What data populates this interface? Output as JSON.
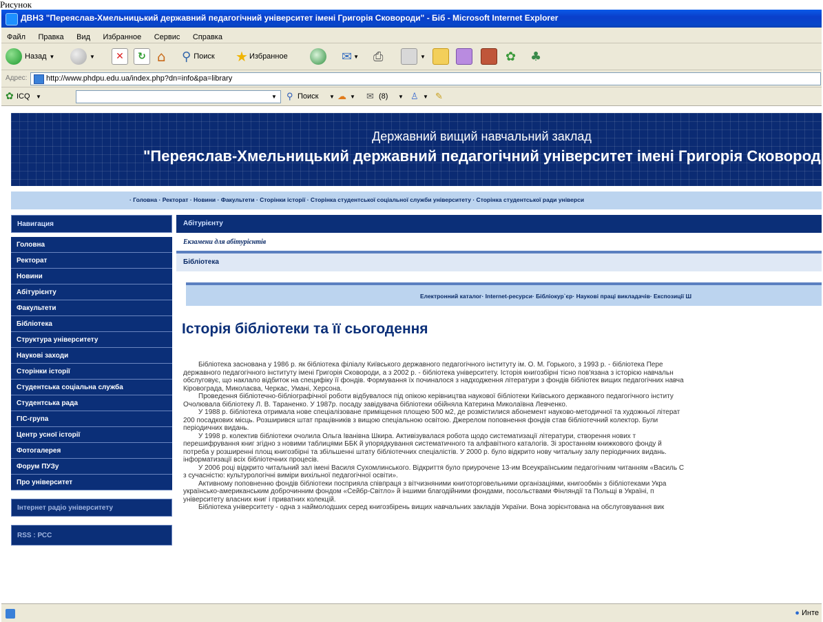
{
  "caption": "Рисунок",
  "window": {
    "title": "ДВНЗ \"Переяслав-Хмельницький державний педагогічний університет імені Григорія Сковороди\" - Біб - Microsoft Internet Explorer"
  },
  "menu": [
    "Файл",
    "Правка",
    "Вид",
    "Избранное",
    "Сервис",
    "Справка"
  ],
  "toolbar": {
    "back": "Назад",
    "search": "Поиск",
    "favorites": "Избранное"
  },
  "address": {
    "label": "Адрес:",
    "url": "http://www.phdpu.edu.ua/index.php?dn=info&pa=library"
  },
  "icqbar": {
    "icq": "ICQ",
    "search": "Поиск",
    "count": "(8)"
  },
  "banner": {
    "line1": "Державний вищий навчальний заклад",
    "line2": "\"Переяслав-Хмельницький державний педагогічний університет імені Григорія Сковороди\""
  },
  "topnav": "· Головна · Ректорат · Новини · Факультети · Сторінки історії · Сторінка студентської соціальної служби університету · Сторінка студентської ради універси",
  "sidebar": {
    "nav_header": "Навигация",
    "items": [
      "Головна",
      "Ректорат",
      "Новини",
      "Абітурієнту",
      "Факультети",
      "Бібліотека",
      "Структура університету",
      "Наукові заходи",
      "Сторінки історії",
      "Студентська соціальна служба",
      "Студентська рада",
      "ГІС-група",
      "Центр усної історії",
      "Фотогалерея",
      "Форум ПУЗу",
      "Про університет"
    ],
    "radio": "Інтернет радіо університету",
    "rss": "RSS : РСС"
  },
  "main": {
    "bar1": "Абітурієнту",
    "exam": "Екзамени для абітурієнтів",
    "bar2": "Бібліотека",
    "libnav": "Електронний каталог· Internet-ресурси· Бібліокур`єр· Наукові праці викладачів· Експозиції Ш",
    "heading": "Історія бібліотеки та її сьогодення",
    "paragraphs": [
      "Бібліотека заснована у 1986 р. як бібліотека філіалу Київського державного педагогічного інституту ім. О. М. Горького, з 1993 р. - бібліотека Пере",
      "державного педагогічного інституту імені Григорія Сковороди, а з 2002 р. - бібліотека університету. Історія книгозбірні тісно пов'язана з історією навчальн",
      "обслуговує, що наклало відбиток на специфіку її фондів. Формування їх починалося з надходження літератури з фондів бібліотек вищих педагогічних навча",
      "Кіровограда, Миколаєва, Черкас, Умані, Херсона.",
      "Проведення бібліотечно-бібліографічної роботи відбувалося під опікою керівництва наукової бібліотеки Київського державного педагогічного інститу",
      "Очолювала бібліотеку Л. В. Тараненко. У 1987р. посаду завідувача бібліотеки обійняла Катерина Миколаївна Левченко.",
      "У 1988 р. бібліотека отримала нове спеціалізоване приміщення площею 500 м2, де розмістилися абонемент науково-методичної та художньої літерат",
      "200 посадкових місць. Розширився штат працівників з вищою спеціальною освітою. Джерелом поповнення фондів став бібліотечний колектор. Були",
      "періодичних видань.",
      "У 1998 р. колектив бібліотеки очолила Ольга Іванівна Шкира. Активізувалася робота щодо систематизації літератури, створення нових т",
      "перешифрування книг згідно з новими таблицями ББК й упорядкування систематичного та алфавітного каталогів. Зі зростанням книжкового фонду й",
      "потреба у розширенні площ книгозбірні та збільшенні штату бібліотечних спеціалістів. У 2000 р. було відкрито нову читальну залу періодичних видань.",
      "інформатизації всіх бібліотечних процесів.",
      "У 2006 році відкрито читальний зал імені Василя Сухомлинського. Відкриття було приурочене 13-им Всеукраїнським педагогічним читанням «Василь С",
      "з сучасністю: культурологічні виміри вихільної педагогічної освіти».",
      "Активному поповненню фондів бібліотеки посприяла співпраця з вітчизняними книготорговельними організаціями, книгообмін з бібліотеками Укра",
      "українсько-американським доброчинним фондом «Сейбр-Світло» й іншими благодійними фондами, посольствами Фінляндії та Польщі в Україні, п",
      "університету власних книг і приватних колекцій.",
      "Бібліотека університету - одна з наймолодших серед книгозбірень вищих навчальних закладів України. Вона зорієнтована на обслуговування вик"
    ],
    "indent": [
      true,
      false,
      false,
      false,
      true,
      false,
      true,
      false,
      false,
      true,
      false,
      false,
      false,
      true,
      false,
      true,
      false,
      false,
      true
    ]
  },
  "status": {
    "zone": "Инте"
  }
}
